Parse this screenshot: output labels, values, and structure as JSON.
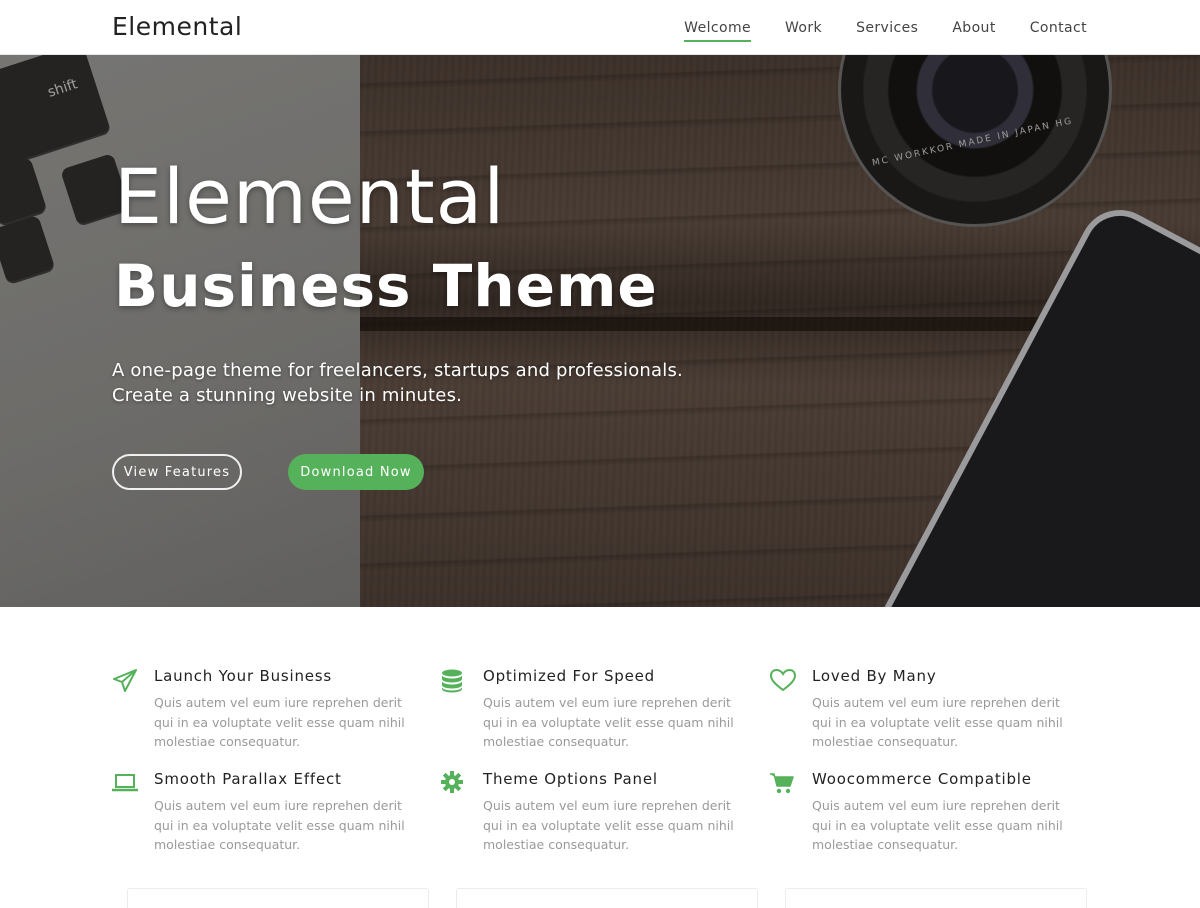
{
  "header": {
    "brand": "Elemental",
    "nav": [
      {
        "label": "Welcome",
        "active": true
      },
      {
        "label": "Work",
        "active": false
      },
      {
        "label": "Services",
        "active": false
      },
      {
        "label": "About",
        "active": false
      },
      {
        "label": "Contact",
        "active": false
      }
    ]
  },
  "hero": {
    "title": "Elemental",
    "subtitle": "Business Theme",
    "description_lines": [
      "A one-page theme for freelancers, startups and professionals.",
      "Create a stunning website in minutes."
    ],
    "buttons": {
      "view_features": "View Features",
      "download_now": "Download Now"
    },
    "keyboard_shift_label": "shift",
    "lens_ring_text": "MC WORKKOR  MADE IN JAPAN  HG"
  },
  "features": [
    {
      "icon": "paper-plane-icon",
      "title": "Launch Your Business",
      "text": "Quis autem vel eum iure reprehen derit qui in ea voluptate velit esse quam nihil molestiae consequatur."
    },
    {
      "icon": "database-icon",
      "title": "Optimized For Speed",
      "text": "Quis autem vel eum iure reprehen derit qui in ea voluptate velit esse quam nihil molestiae consequatur."
    },
    {
      "icon": "heart-icon",
      "title": "Loved By Many",
      "text": "Quis autem vel eum iure reprehen derit qui in ea voluptate velit esse quam nihil molestiae consequatur."
    },
    {
      "icon": "laptop-icon",
      "title": "Smooth Parallax Effect",
      "text": "Quis autem vel eum iure reprehen derit qui in ea voluptate velit esse quam nihil molestiae consequatur."
    },
    {
      "icon": "gear-icon",
      "title": "Theme Options Panel",
      "text": "Quis autem vel eum iure reprehen derit qui in ea voluptate velit esse quam nihil molestiae consequatur."
    },
    {
      "icon": "cart-icon",
      "title": "Woocommerce Compatible",
      "text": "Quis autem vel eum iure reprehen derit qui in ea voluptate velit esse quam nihil molestiae consequatur."
    }
  ],
  "colors": {
    "accent": "#56b15b",
    "heading": "#222222",
    "muted_text": "#9a9a9a"
  }
}
